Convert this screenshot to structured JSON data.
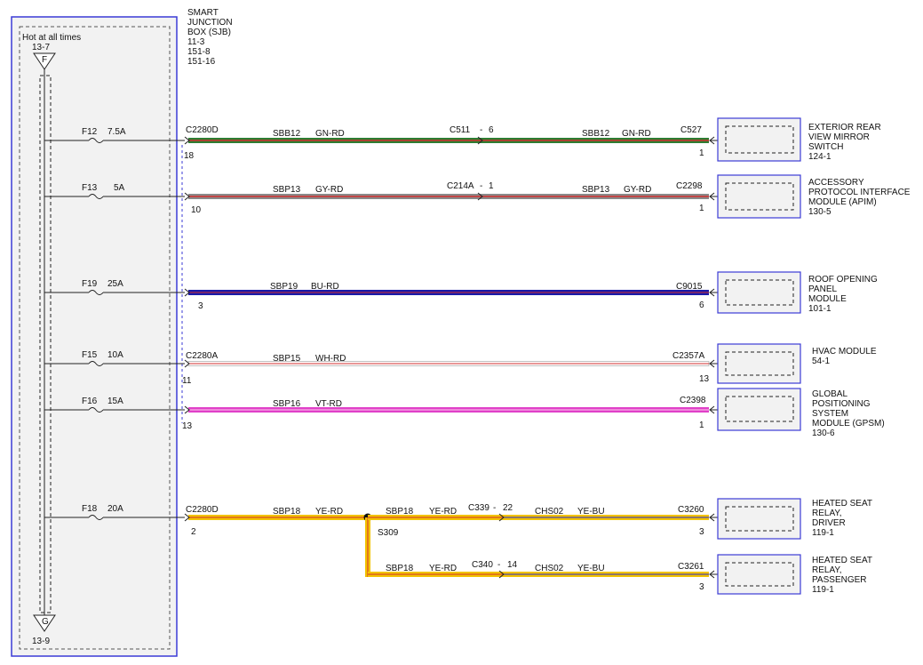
{
  "sjb": {
    "title": [
      "SMART",
      "JUNCTION",
      "BOX (SJB)",
      "11-3",
      "151-8",
      "151-16"
    ],
    "hot_label": "Hot at all times",
    "top_ref": "13-7",
    "top_letter": "F",
    "bottom_letter": "G",
    "bottom_ref": "13-9"
  },
  "circuits": [
    {
      "fuse": "F12",
      "amp": "7.5A",
      "sjb_conn": "C2280D",
      "sjb_pin": "18",
      "seg1_circuit": "SBB12",
      "seg1_color": "GN-RD",
      "mid_conn": "C511",
      "mid_pin": "6",
      "seg2_circuit": "SBB12",
      "seg2_color": "GN-RD",
      "end_conn": "C527",
      "end_pin": "1",
      "wire_base": "#2e7d32",
      "wire_stripe": "#d32f2f",
      "module": [
        "EXTERIOR REAR",
        "VIEW MIRROR",
        "SWITCH",
        "124-1"
      ]
    },
    {
      "fuse": "F13",
      "amp": "5A",
      "sjb_conn": "",
      "sjb_pin": "10",
      "seg1_circuit": "SBP13",
      "seg1_color": "GY-RD",
      "mid_conn": "C214A",
      "mid_pin": "1",
      "seg2_circuit": "SBP13",
      "seg2_color": "GY-RD",
      "end_conn": "C2298",
      "end_pin": "1",
      "wire_base": "#8a8a8a",
      "wire_stripe": "#d32f2f",
      "module": [
        "ACCESSORY",
        "PROTOCOL INTERFACE",
        "MODULE (APIM)",
        "130-5"
      ]
    },
    {
      "fuse": "F19",
      "amp": "25A",
      "sjb_conn": "",
      "sjb_pin": "3",
      "seg1_circuit": "SBP19",
      "seg1_color": "BU-RD",
      "mid_conn": "",
      "mid_pin": "",
      "seg2_circuit": "",
      "seg2_color": "",
      "end_conn": "C9015",
      "end_pin": "6",
      "wire_base": "#1a1aa8",
      "wire_stripe": "#d32f2f",
      "module": [
        "ROOF OPENING",
        "PANEL",
        "MODULE",
        "101-1"
      ]
    },
    {
      "fuse": "F15",
      "amp": "10A",
      "sjb_conn": "C2280A",
      "sjb_pin": "11",
      "seg1_circuit": "SBP15",
      "seg1_color": "WH-RD",
      "mid_conn": "",
      "mid_pin": "",
      "seg2_circuit": "",
      "seg2_color": "",
      "end_conn": "C2357A",
      "end_pin": "13",
      "wire_base": "#f2f2f2",
      "wire_stripe": "#d32f2f",
      "module": [
        "HVAC MODULE",
        "54-1"
      ]
    },
    {
      "fuse": "F16",
      "amp": "15A",
      "sjb_conn": "",
      "sjb_pin": "13",
      "seg1_circuit": "SBP16",
      "seg1_color": "VT-RD",
      "mid_conn": "",
      "mid_pin": "",
      "seg2_circuit": "",
      "seg2_color": "",
      "end_conn": "C2398",
      "end_pin": "1",
      "wire_base": "#e040c8",
      "wire_stripe": "#d32f2f",
      "module": [
        "GLOBAL",
        "POSITIONING",
        "SYSTEM",
        "MODULE (GPSM)",
        "130-6"
      ]
    },
    {
      "fuse": "F18",
      "amp": "20A",
      "sjb_conn": "C2280D",
      "sjb_pin": "2",
      "seg1_circuit": "SBP18",
      "seg1_color": "YE-RD",
      "splice": "S309",
      "branches": [
        {
          "circuit": "SBP18",
          "color": "YE-RD",
          "mid_conn": "C339",
          "mid_pin": "22",
          "seg2_circuit": "CHS02",
          "seg2_color": "YE-BU",
          "end_conn": "C3260",
          "end_pin": "3",
          "module": [
            "HEATED SEAT",
            "RELAY,",
            "DRIVER",
            "119-1"
          ]
        },
        {
          "circuit": "SBP18",
          "color": "YE-RD",
          "mid_conn": "C340",
          "mid_pin": "14",
          "seg2_circuit": "CHS02",
          "seg2_color": "YE-BU",
          "end_conn": "C3261",
          "end_pin": "3",
          "module": [
            "HEATED SEAT",
            "RELAY,",
            "PASSENGER",
            "119-1"
          ]
        }
      ],
      "wire_base": "#f2c300",
      "wire_stripe": "#d32f2f",
      "branch_base": "#f2c300",
      "branch_stripe": "#2a2ad0"
    }
  ],
  "colors": {
    "box_border": "#3b3bd6",
    "box_fill": "#f2f2f2",
    "line": "#222222"
  }
}
